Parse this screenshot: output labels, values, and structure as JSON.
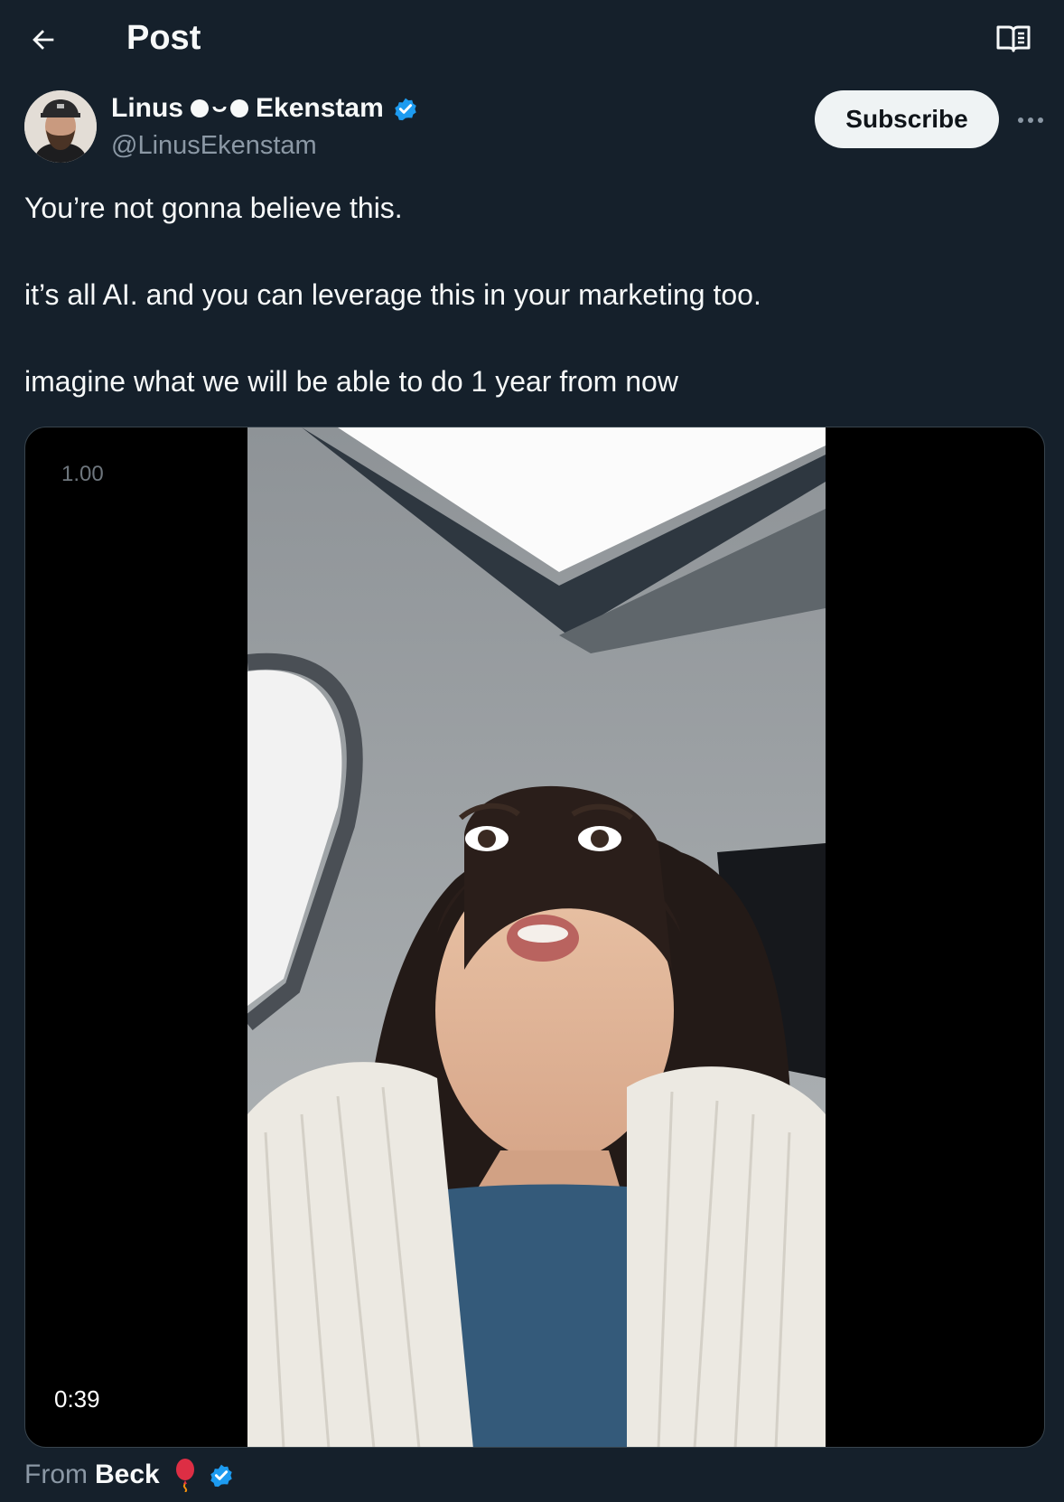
{
  "header": {
    "title": "Post"
  },
  "author": {
    "name_first": "Linus",
    "name_last": "Ekenstam",
    "handle": "@LinusEkenstam",
    "verified": true
  },
  "actions": {
    "subscribe_label": "Subscribe"
  },
  "post": {
    "lines": [
      "You’re not gonna believe this.",
      "it’s all AI. and you can leverage this in your marketing too.",
      "imagine what we will be able to do 1 year from now"
    ]
  },
  "video": {
    "playback_rate": "1.00",
    "duration": "0:39"
  },
  "attribution": {
    "prefix": "From",
    "name": "Beck"
  },
  "colors": {
    "background": "#15202b",
    "verified": "#1d9bf0",
    "text": "#f7f9f9",
    "muted": "#8b98a5"
  }
}
